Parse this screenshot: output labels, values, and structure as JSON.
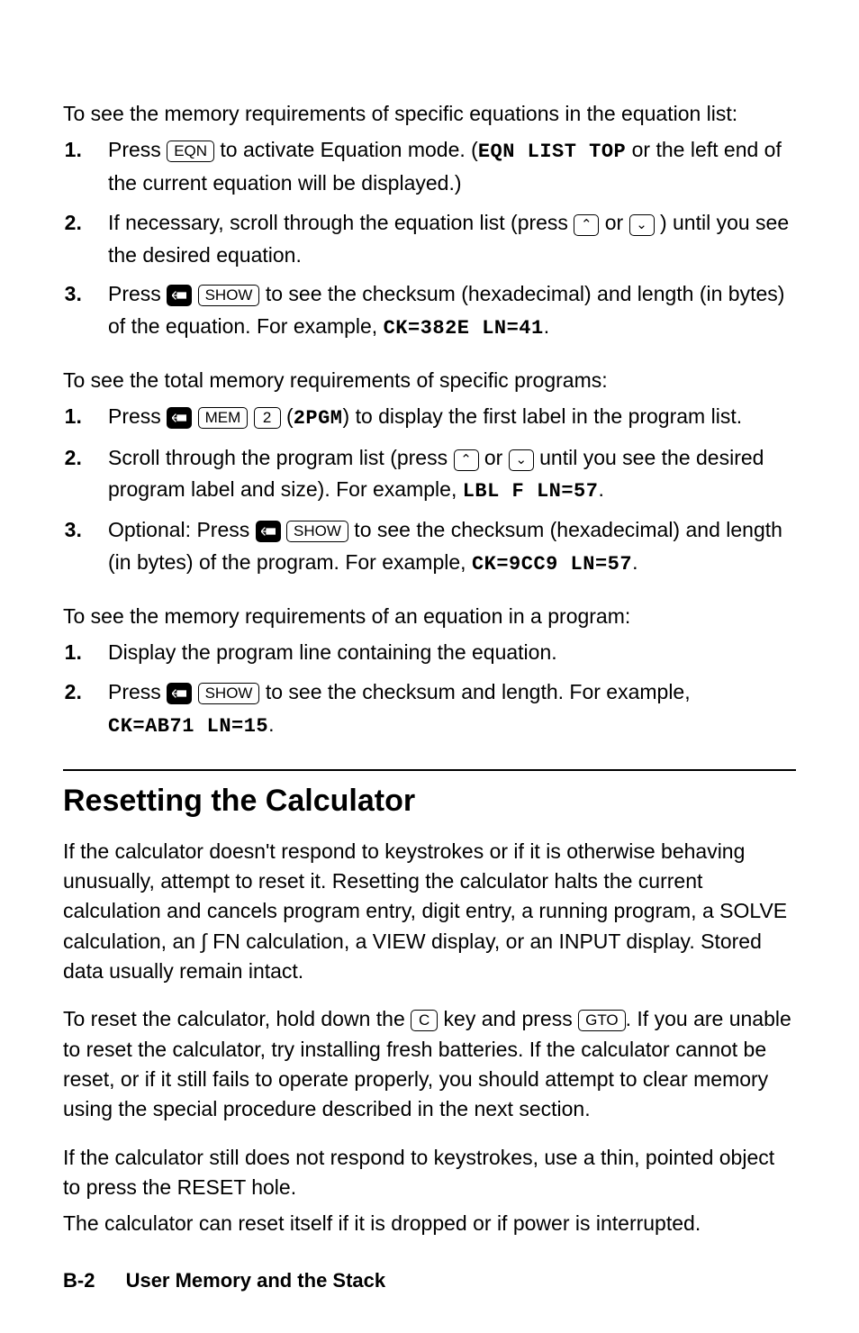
{
  "keys": {
    "eqn": "EQN",
    "show": "SHOW",
    "mem": "MEM",
    "two": "2",
    "c": "C",
    "gto": "GTO",
    "up": "⌃",
    "down": "⌄"
  },
  "lcd": {
    "eqnListTop": "EQN LIST TOP",
    "ck382": "CK=382E  LN=41",
    "twoPgm": "2PGM",
    "lblF": "LBL F  LN=57",
    "ck9cc9": "CK=9CC9  LN=57",
    "ckab71": "CK=AB71  LN=15"
  },
  "block1": {
    "intro": "To see the memory requirements of specific equations in the equation list:",
    "s1a": "Press ",
    "s1b": " to activate Equation mode. (",
    "s1c": " or the left end of the current equation will be displayed.)",
    "s2a": "If necessary, scroll through the equation list (press ",
    "s2or": " or ",
    "s2b": " ) until you see the desired equation.",
    "s3a": "Press ",
    "s3b": " to see the checksum (hexadecimal) and length (in bytes) of the equation. For example, ",
    "s3c": "."
  },
  "block2": {
    "intro": "To see the total memory requirements of specific programs:",
    "s1a": "Press ",
    "s1b": " (",
    "s1c": ") to display the first label in the program list.",
    "s2a": "Scroll through the program list (press ",
    "s2or": " or ",
    "s2b": " until you see the desired program label and size). For example, ",
    "s2c": ".",
    "s3a": "Optional: Press ",
    "s3b": " to see the checksum (hexadecimal) and length (in bytes) of the program. For example, ",
    "s3c": "."
  },
  "block3": {
    "intro": "To see the memory requirements of an equation in a program:",
    "s1": "Display the program line containing the equation.",
    "s2a": "Press ",
    "s2b": " to see the checksum and length. For example, ",
    "s2c": "."
  },
  "section": {
    "title": "Resetting the Calculator",
    "p1": "If the calculator doesn't respond to keystrokes or if it is otherwise behaving unusually, attempt to reset it. Resetting the calculator halts the current calculation and cancels program entry, digit entry, a running program, a SOLVE calculation, an ∫ FN calculation, a VIEW display, or an INPUT display. Stored data usually remain intact.",
    "p2a": "To reset the calculator, hold down the ",
    "p2b": " key and press ",
    "p2c": ". If you are unable to reset the calculator, try installing fresh batteries. If the calculator cannot be reset, or if it still fails to operate properly, you should attempt to clear memory using the special procedure described in the next section.",
    "p3": "If the calculator still does not respond to keystrokes, use a thin, pointed object to press the RESET hole.",
    "p4": "The calculator can reset itself if it is dropped or if power is interrupted."
  },
  "footer": {
    "page": "B-2",
    "title": "User Memory and the Stack"
  }
}
